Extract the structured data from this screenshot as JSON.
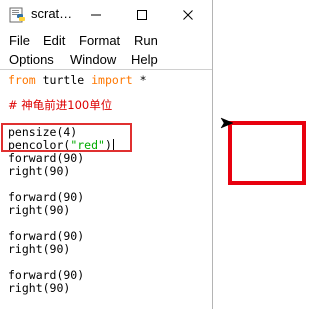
{
  "window": {
    "title": "scrat…",
    "minimize_icon": "minimize-icon",
    "maximize_icon": "maximize-icon",
    "close_icon": "close-icon"
  },
  "menu": {
    "row1": [
      "File",
      "Edit",
      "Format",
      "Run"
    ],
    "row2": [
      "Options",
      "Window",
      "Help"
    ]
  },
  "code": {
    "line1_kw1": "from",
    "line1_mid": " turtle ",
    "line1_kw2": "import",
    "line1_end": " *",
    "comment": "# 神龟前进100单位",
    "pensize": "pensize(4)",
    "pencolor_pre": "pencolor(",
    "pencolor_arg": "\"red\"",
    "pencolor_post": ")",
    "forward_1": "forward(90)",
    "right_1": "right(90)",
    "forward_2": "forward(90)",
    "right_2": "right(90)",
    "forward_3": "forward(90)",
    "right_3": "right(90)",
    "forward_4": "forward(90)",
    "right_4": "right(90)"
  },
  "colors": {
    "keyword": "#ff7700",
    "comment": "#dd0000",
    "string": "#00aa00",
    "highlight": "#e03030",
    "pen": "#e8000e"
  }
}
